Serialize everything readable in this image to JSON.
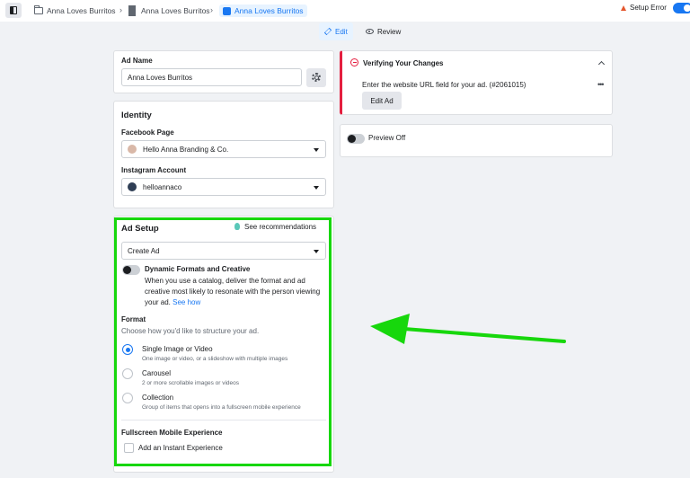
{
  "breadcrumb": {
    "campaign": "Anna Loves Burritos",
    "adset": "Anna Loves Burritos",
    "ad": "Anna Loves Burritos"
  },
  "status": {
    "setup_error": "Setup Error"
  },
  "tabs": {
    "edit": "Edit",
    "review": "Review"
  },
  "ad_name": {
    "label": "Ad Name",
    "value": "Anna Loves Burritos"
  },
  "identity": {
    "heading": "Identity",
    "facebook_label": "Facebook Page",
    "facebook_value": "Hello Anna Branding & Co.",
    "instagram_label": "Instagram Account",
    "instagram_value": "helloannaco"
  },
  "ad_setup": {
    "heading": "Ad Setup",
    "recommendations": "See recommendations",
    "create_select": "Create Ad",
    "dynamic_title": "Dynamic Formats and Creative",
    "dynamic_desc": "When you use a catalog, deliver the format and ad creative most likely to resonate with the person viewing your ad.",
    "dynamic_link": "See how",
    "format_heading": "Format",
    "format_desc": "Choose how you'd like to structure your ad.",
    "options": [
      {
        "title": "Single Image or Video",
        "sub": "One image or video, or a slideshow with multiple images",
        "selected": true
      },
      {
        "title": "Carousel",
        "sub": "2 or more scrollable images or videos",
        "selected": false
      },
      {
        "title": "Collection",
        "sub": "Group of items that opens into a fullscreen mobile experience",
        "selected": false
      }
    ],
    "fullscreen_heading": "Fullscreen Mobile Experience",
    "instant_experience": "Add an Instant Experience"
  },
  "verify": {
    "title": "Verifying Your Changes",
    "message": "Enter the website URL field for your ad. (#2061015)",
    "button": "Edit Ad"
  },
  "preview": {
    "label": "Preview Off"
  },
  "colors": {
    "accent": "#1877f2",
    "error": "#e41e3f",
    "highlight": "#17d70c"
  }
}
